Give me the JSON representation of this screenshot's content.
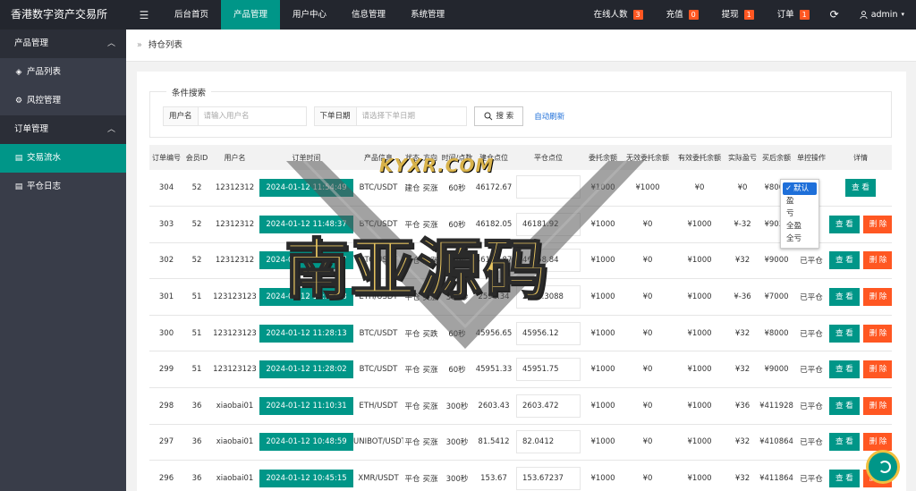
{
  "app": {
    "title": "香港数字资产交易所",
    "menu_icon": "hamburger-icon"
  },
  "nav": [
    "后台首页",
    "产品管理",
    "用户中心",
    "信息管理",
    "系统管理"
  ],
  "nav_active": 1,
  "right_nav": {
    "online": {
      "label": "在线人数",
      "count": "3"
    },
    "recharge": {
      "label": "充值",
      "count": "0"
    },
    "withdraw": {
      "label": "提现",
      "count": "1"
    },
    "orders": {
      "label": "订单",
      "count": "1"
    },
    "refresh_icon": "refresh-icon",
    "user": "admin"
  },
  "sidebar": {
    "group1": "产品管理",
    "items1": [
      {
        "label": "产品列表",
        "icon": "layers-icon"
      },
      {
        "label": "风控管理",
        "icon": "gear-icon"
      }
    ],
    "group2": "订单管理",
    "items2": [
      {
        "label": "交易流水",
        "icon": "document-icon"
      },
      {
        "label": "平仓日志",
        "icon": "document-icon"
      }
    ]
  },
  "breadcrumb": "持仓列表",
  "search": {
    "legend": "条件搜索",
    "username_label": "用户名",
    "username_placeholder": "请输入用户名",
    "date_label": "下单日期",
    "date_placeholder": "请选择下单日期",
    "search_button": "搜 索",
    "auto_refresh": "自动刷新"
  },
  "table": {
    "headers": [
      "订单编号",
      "会员ID",
      "用户名",
      "订单时间",
      "产品信息",
      "状态",
      "方向",
      "时间/点数",
      "建仓点位",
      "平仓点位",
      "委托余额",
      "无效委托余额",
      "有效委托余额",
      "实际盈亏",
      "买后余额",
      "单控操作",
      "详情"
    ],
    "rows": [
      {
        "id": "304",
        "member": "52",
        "user": "12312312",
        "time": "2024-01-12 11:54:49",
        "product": "BTC/USDT",
        "status": "建仓",
        "dir": "买涨",
        "dur": "60秒",
        "open": "46172.67",
        "close": "",
        "entrust": "¥1000",
        "invalid": "¥1000",
        "valid": "¥0",
        "pnl": "¥0",
        "after": "¥8000",
        "ctrl": "",
        "del": false
      },
      {
        "id": "303",
        "member": "52",
        "user": "12312312",
        "time": "2024-01-12 11:48:37",
        "product": "BTC/USDT",
        "status": "平仓",
        "dir": "买涨",
        "dur": "60秒",
        "open": "46182.05",
        "close": "46181.92",
        "entrust": "¥1000",
        "invalid": "¥0",
        "valid": "¥1000",
        "pnl": "¥-32",
        "after": "¥9032",
        "ctrl": "",
        "del": true
      },
      {
        "id": "302",
        "member": "52",
        "user": "12312312",
        "time": "2024-01-12 11:47:07",
        "product": "BTC/USDT",
        "status": "平仓",
        "dir": "买涨",
        "dur": "60秒",
        "open": "46159.87",
        "close": "46158.84",
        "entrust": "¥1000",
        "invalid": "¥0",
        "valid": "¥1000",
        "pnl": "¥32",
        "after": "¥9000",
        "ctrl": "已平仓",
        "del": true
      },
      {
        "id": "301",
        "member": "51",
        "user": "123123123",
        "time": "2024-01-12 11:28:28",
        "product": "ETH/USDT",
        "status": "平仓",
        "dir": "买涨",
        "dur": "300秒",
        "open": "2592.34",
        "close": "2592.3088",
        "entrust": "¥1000",
        "invalid": "¥0",
        "valid": "¥1000",
        "pnl": "¥-36",
        "after": "¥7000",
        "ctrl": "已平仓",
        "del": true
      },
      {
        "id": "300",
        "member": "51",
        "user": "123123123",
        "time": "2024-01-12 11:28:13",
        "product": "BTC/USDT",
        "status": "平仓",
        "dir": "买跌",
        "dur": "60秒",
        "open": "45956.65",
        "close": "45956.12",
        "entrust": "¥1000",
        "invalid": "¥0",
        "valid": "¥1000",
        "pnl": "¥32",
        "after": "¥8000",
        "ctrl": "已平仓",
        "del": true
      },
      {
        "id": "299",
        "member": "51",
        "user": "123123123",
        "time": "2024-01-12 11:28:02",
        "product": "BTC/USDT",
        "status": "平仓",
        "dir": "买涨",
        "dur": "60秒",
        "open": "45951.33",
        "close": "45951.75",
        "entrust": "¥1000",
        "invalid": "¥0",
        "valid": "¥1000",
        "pnl": "¥32",
        "after": "¥9000",
        "ctrl": "已平仓",
        "del": true
      },
      {
        "id": "298",
        "member": "36",
        "user": "xiaobai01",
        "time": "2024-01-12 11:10:31",
        "product": "ETH/USDT",
        "status": "平仓",
        "dir": "买涨",
        "dur": "300秒",
        "open": "2603.43",
        "close": "2603.472",
        "entrust": "¥1000",
        "invalid": "¥0",
        "valid": "¥1000",
        "pnl": "¥36",
        "after": "¥411928",
        "ctrl": "已平仓",
        "del": true
      },
      {
        "id": "297",
        "member": "36",
        "user": "xiaobai01",
        "time": "2024-01-12 10:48:59",
        "product": "UNIBOT/USDT",
        "status": "平仓",
        "dir": "买涨",
        "dur": "300秒",
        "open": "81.5412",
        "close": "82.0412",
        "entrust": "¥1000",
        "invalid": "¥0",
        "valid": "¥1000",
        "pnl": "¥32",
        "after": "¥410864",
        "ctrl": "已平仓",
        "del": true
      },
      {
        "id": "296",
        "member": "36",
        "user": "xiaobai01",
        "time": "2024-01-12 10:45:15",
        "product": "XMR/USDT",
        "status": "平仓",
        "dir": "买涨",
        "dur": "300秒",
        "open": "153.67",
        "close": "153.67237",
        "entrust": "¥1000",
        "invalid": "¥0",
        "valid": "¥1000",
        "pnl": "¥32",
        "after": "¥411864",
        "ctrl": "已平仓",
        "del": true
      }
    ],
    "view_label": "查 看",
    "delete_label": "删 除"
  },
  "control_dropdown": {
    "options": [
      "默认",
      "盈",
      "亏",
      "全盈",
      "全亏"
    ],
    "selected": "默认"
  },
  "watermark": {
    "top": "KYXR.COM",
    "main": "南亚源码"
  },
  "colors": {
    "accent": "#009688",
    "header": "#23262e",
    "sidebar": "#393d49",
    "danger": "#ff5722"
  }
}
